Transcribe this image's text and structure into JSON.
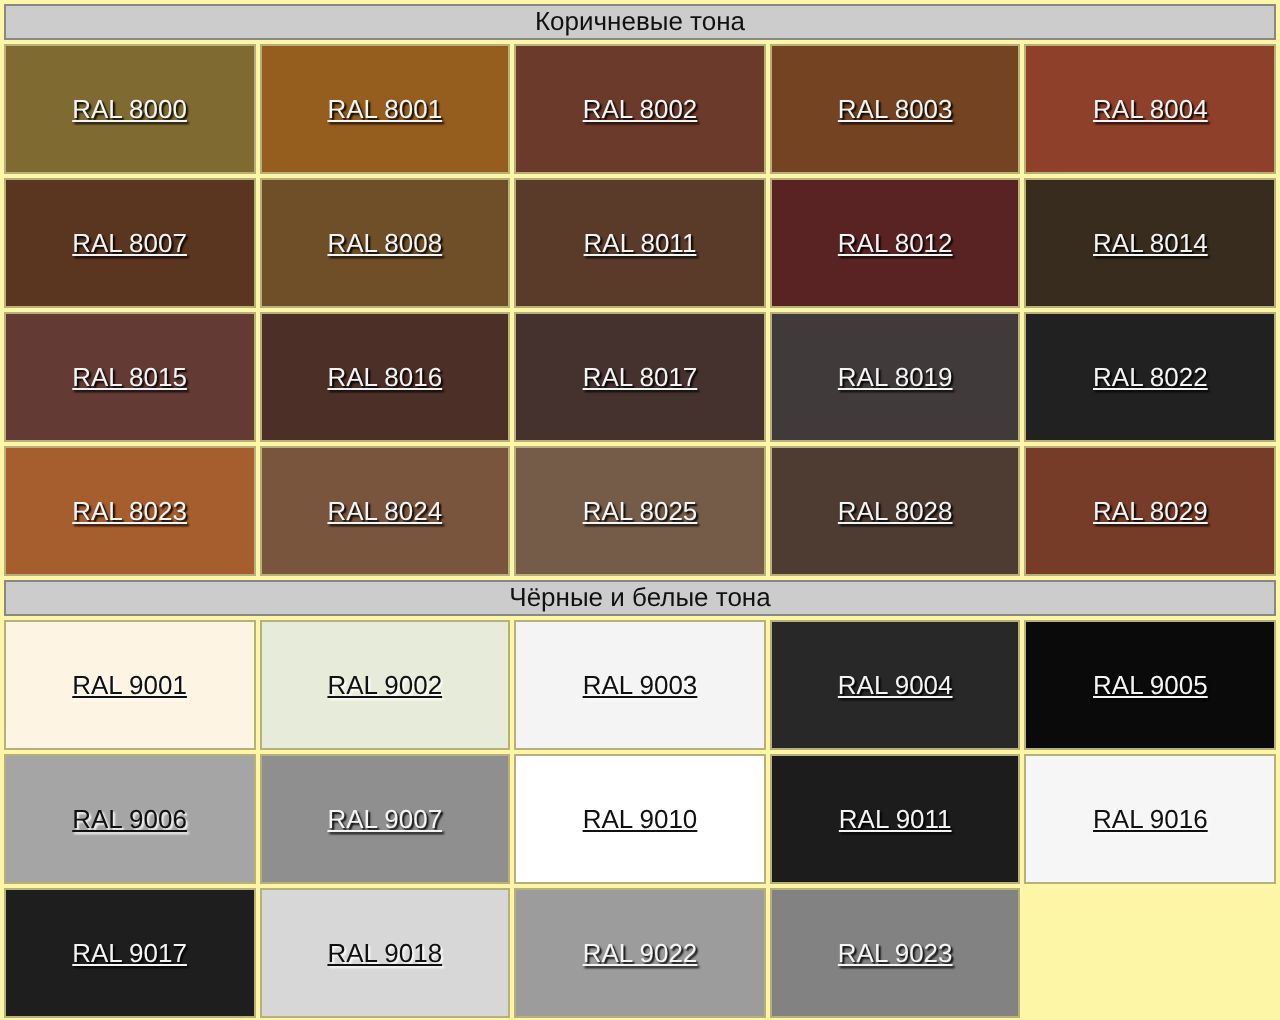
{
  "sections": [
    {
      "title": "Коричневые тона",
      "swatches": [
        {
          "label": "RAL 8000",
          "color": "#7f6b32",
          "kind": "light"
        },
        {
          "label": "RAL 8001",
          "color": "#955d1e",
          "kind": "light"
        },
        {
          "label": "RAL 8002",
          "color": "#6c3a2b",
          "kind": "light"
        },
        {
          "label": "RAL 8003",
          "color": "#744422",
          "kind": "light"
        },
        {
          "label": "RAL 8004",
          "color": "#8e402a",
          "kind": "light"
        },
        {
          "label": "RAL 8007",
          "color": "#5a3520",
          "kind": "light"
        },
        {
          "label": "RAL 8008",
          "color": "#6f4f28",
          "kind": "light"
        },
        {
          "label": "RAL 8011",
          "color": "#5a3a29",
          "kind": "light"
        },
        {
          "label": "RAL 8012",
          "color": "#5a2323",
          "kind": "light"
        },
        {
          "label": "RAL 8014",
          "color": "#382c1e",
          "kind": "light"
        },
        {
          "label": "RAL 8015",
          "color": "#633a34",
          "kind": "light"
        },
        {
          "label": "RAL 8016",
          "color": "#4c2f27",
          "kind": "light"
        },
        {
          "label": "RAL 8017",
          "color": "#45322e",
          "kind": "light"
        },
        {
          "label": "RAL 8019",
          "color": "#403a3a",
          "kind": "light"
        },
        {
          "label": "RAL 8022",
          "color": "#212121",
          "kind": "light"
        },
        {
          "label": "RAL 8023",
          "color": "#a65e2e",
          "kind": "light"
        },
        {
          "label": "RAL 8024",
          "color": "#79553d",
          "kind": "light"
        },
        {
          "label": "RAL 8025",
          "color": "#755c48",
          "kind": "light"
        },
        {
          "label": "RAL 8028",
          "color": "#4e3b31",
          "kind": "light"
        },
        {
          "label": "RAL 8029",
          "color": "#763c28",
          "kind": "light"
        }
      ]
    },
    {
      "title": "Чёрные и белые тона",
      "swatches": [
        {
          "label": "RAL 9001",
          "color": "#fdf4e3",
          "kind": "dark"
        },
        {
          "label": "RAL 9002",
          "color": "#e7ebda",
          "kind": "dark"
        },
        {
          "label": "RAL 9003",
          "color": "#f4f4f4",
          "kind": "dark"
        },
        {
          "label": "RAL 9004",
          "color": "#282828",
          "kind": "light"
        },
        {
          "label": "RAL 9005",
          "color": "#0a0a0a",
          "kind": "light"
        },
        {
          "label": "RAL 9006",
          "color": "#a5a5a5",
          "kind": "dark"
        },
        {
          "label": "RAL 9007",
          "color": "#8f8f8f",
          "kind": "light"
        },
        {
          "label": "RAL 9010",
          "color": "#ffffff",
          "kind": "dark"
        },
        {
          "label": "RAL 9011",
          "color": "#1c1c1c",
          "kind": "light"
        },
        {
          "label": "RAL 9016",
          "color": "#f6f6f6",
          "kind": "dark"
        },
        {
          "label": "RAL 9017",
          "color": "#1e1e1e",
          "kind": "light"
        },
        {
          "label": "RAL 9018",
          "color": "#d7d7d7",
          "kind": "dark"
        },
        {
          "label": "RAL 9022",
          "color": "#9c9c9c",
          "kind": "light"
        },
        {
          "label": "RAL 9023",
          "color": "#828282",
          "kind": "light"
        }
      ]
    }
  ]
}
